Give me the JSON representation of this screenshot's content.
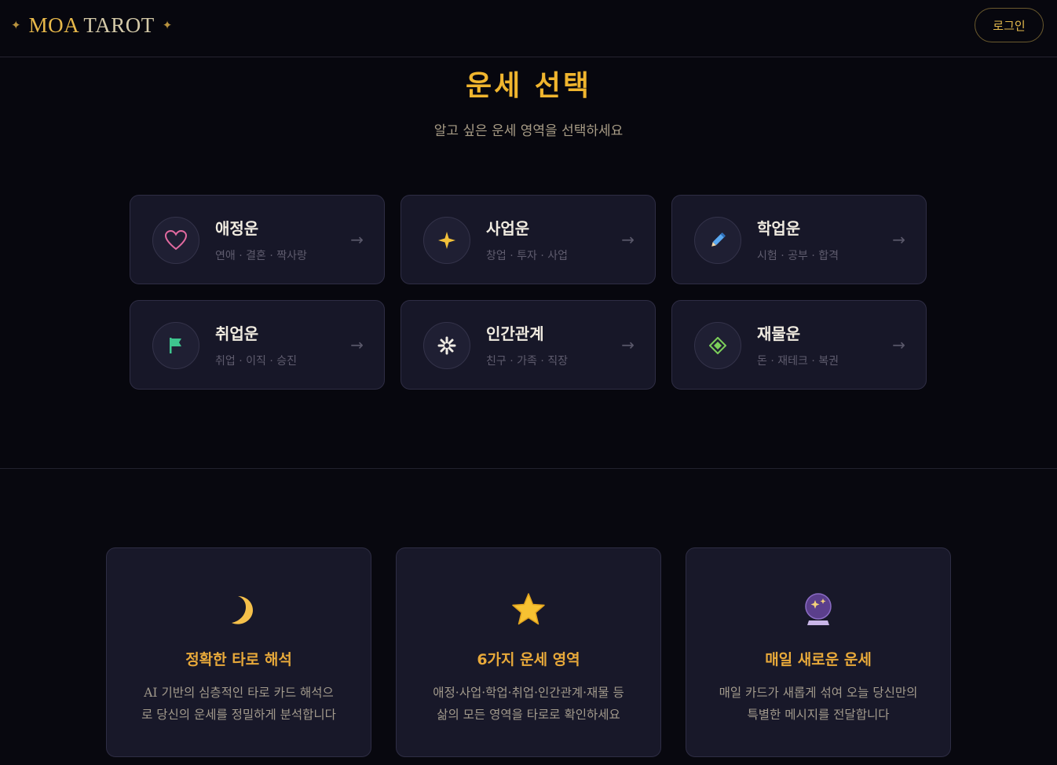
{
  "header": {
    "brand_part1": "MOA",
    "brand_part2": "TAROT",
    "login_label": "로그인"
  },
  "page": {
    "title": "운세 선택",
    "subtitle": "알고 싶은 운세 영역을 선택하세요"
  },
  "categories": [
    {
      "name": "애정운",
      "tags": "연애 · 결혼 · 짝사랑",
      "icon": "heart-icon",
      "color": "#e26aa0"
    },
    {
      "name": "사업운",
      "tags": "창업 · 투자 · 사업",
      "icon": "sparkle-icon",
      "color": "#f2c13a"
    },
    {
      "name": "학업운",
      "tags": "시험 · 공부 · 합격",
      "icon": "pencil-icon",
      "color": "#5aa8f0"
    },
    {
      "name": "취업운",
      "tags": "취업 · 이직 · 승진",
      "icon": "flag-icon",
      "color": "#3ec48e"
    },
    {
      "name": "인간관계",
      "tags": "친구 · 가족 · 직장",
      "icon": "asterisk-icon",
      "color": "#f0ece4"
    },
    {
      "name": "재물운",
      "tags": "돈 · 재테크 · 복권",
      "icon": "diamond-icon",
      "color": "#7ccf5a"
    }
  ],
  "arrow": "→",
  "features": [
    {
      "icon": "crescent-moon-icon",
      "title": "정확한 타로 해석",
      "desc_line1": "AI 기반의 심층적인 타로 카드 해석으",
      "desc_line2": "로 당신의 운세를 정밀하게 분석합니다"
    },
    {
      "icon": "star-icon",
      "title": "6가지 운세 영역",
      "desc_line1": "애정·사업·학업·취업·인간관계·재물 등",
      "desc_line2": "삶의 모든 영역을 타로로 확인하세요"
    },
    {
      "icon": "crystal-ball-icon",
      "title": "매일 새로운 운세",
      "desc_line1": "매일 카드가 새롭게 섞여 오늘 당신만의",
      "desc_line2": "특별한 메시지를 전달합니다"
    }
  ]
}
